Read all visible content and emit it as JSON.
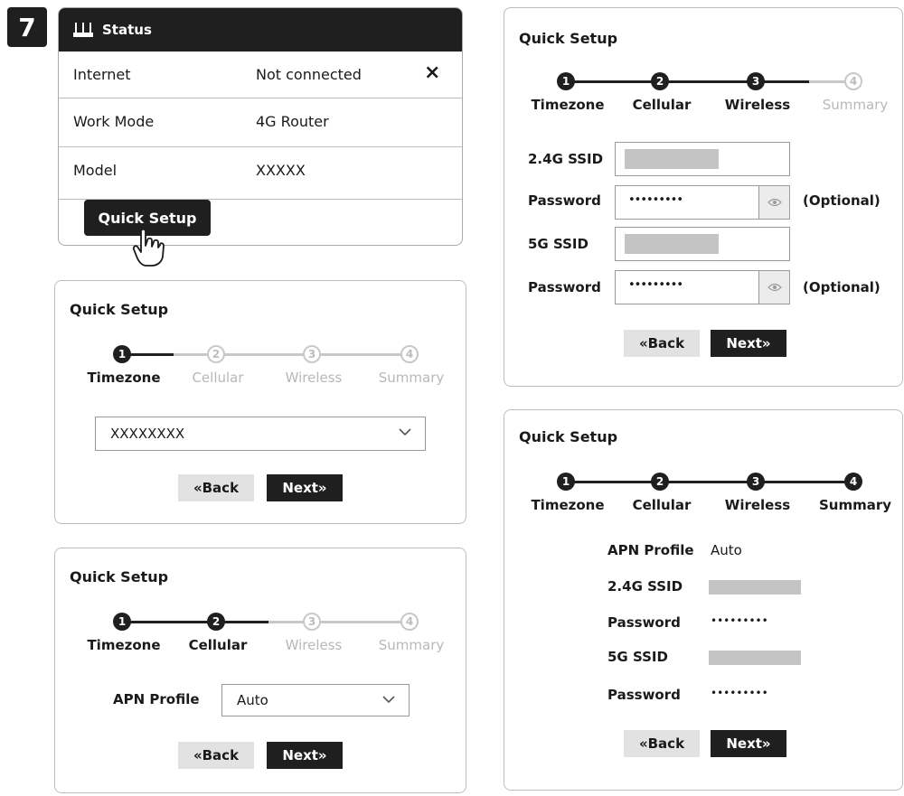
{
  "step_number": "7",
  "status": {
    "title": "Status",
    "rows": [
      {
        "label": "Internet",
        "value": "Not connected",
        "icon": "×"
      },
      {
        "label": "Work Mode",
        "value": "4G Router"
      },
      {
        "label": "Model",
        "value": "XXXXX"
      }
    ],
    "button": "Quick Setup"
  },
  "quick_setup": {
    "title": "Quick Setup",
    "steps": [
      "Timezone",
      "Cellular",
      "Wireless",
      "Summary"
    ],
    "back_label": "«Back",
    "next_label": "Next»"
  },
  "timezone_panel": {
    "current_step": 1,
    "select_value": "XXXXXXXX"
  },
  "cellular_panel": {
    "current_step": 2,
    "apn_label": "APN Profile",
    "apn_value": "Auto"
  },
  "wireless_panel": {
    "current_step": 3,
    "ssid24_label": "2.4G SSID",
    "password_label": "Password",
    "ssid5_label": "5G SSID",
    "password_mask": "•••••••••",
    "optional_label": "(Optional)"
  },
  "summary_panel": {
    "current_step": 4,
    "rows": [
      {
        "label": "APN Profile",
        "value": "Auto",
        "kind": "text"
      },
      {
        "label": "2.4G SSID",
        "value": "",
        "kind": "redacted"
      },
      {
        "label": "Password",
        "value": "•••••••••",
        "kind": "text"
      },
      {
        "label": "5G SSID",
        "value": "",
        "kind": "redacted"
      },
      {
        "label": "Password",
        "value": "•••••••••",
        "kind": "text"
      }
    ]
  },
  "colors": {
    "dark": "#1f1f1f",
    "inactive": "#c8c8c8",
    "redacted": "#c4c4c4"
  }
}
